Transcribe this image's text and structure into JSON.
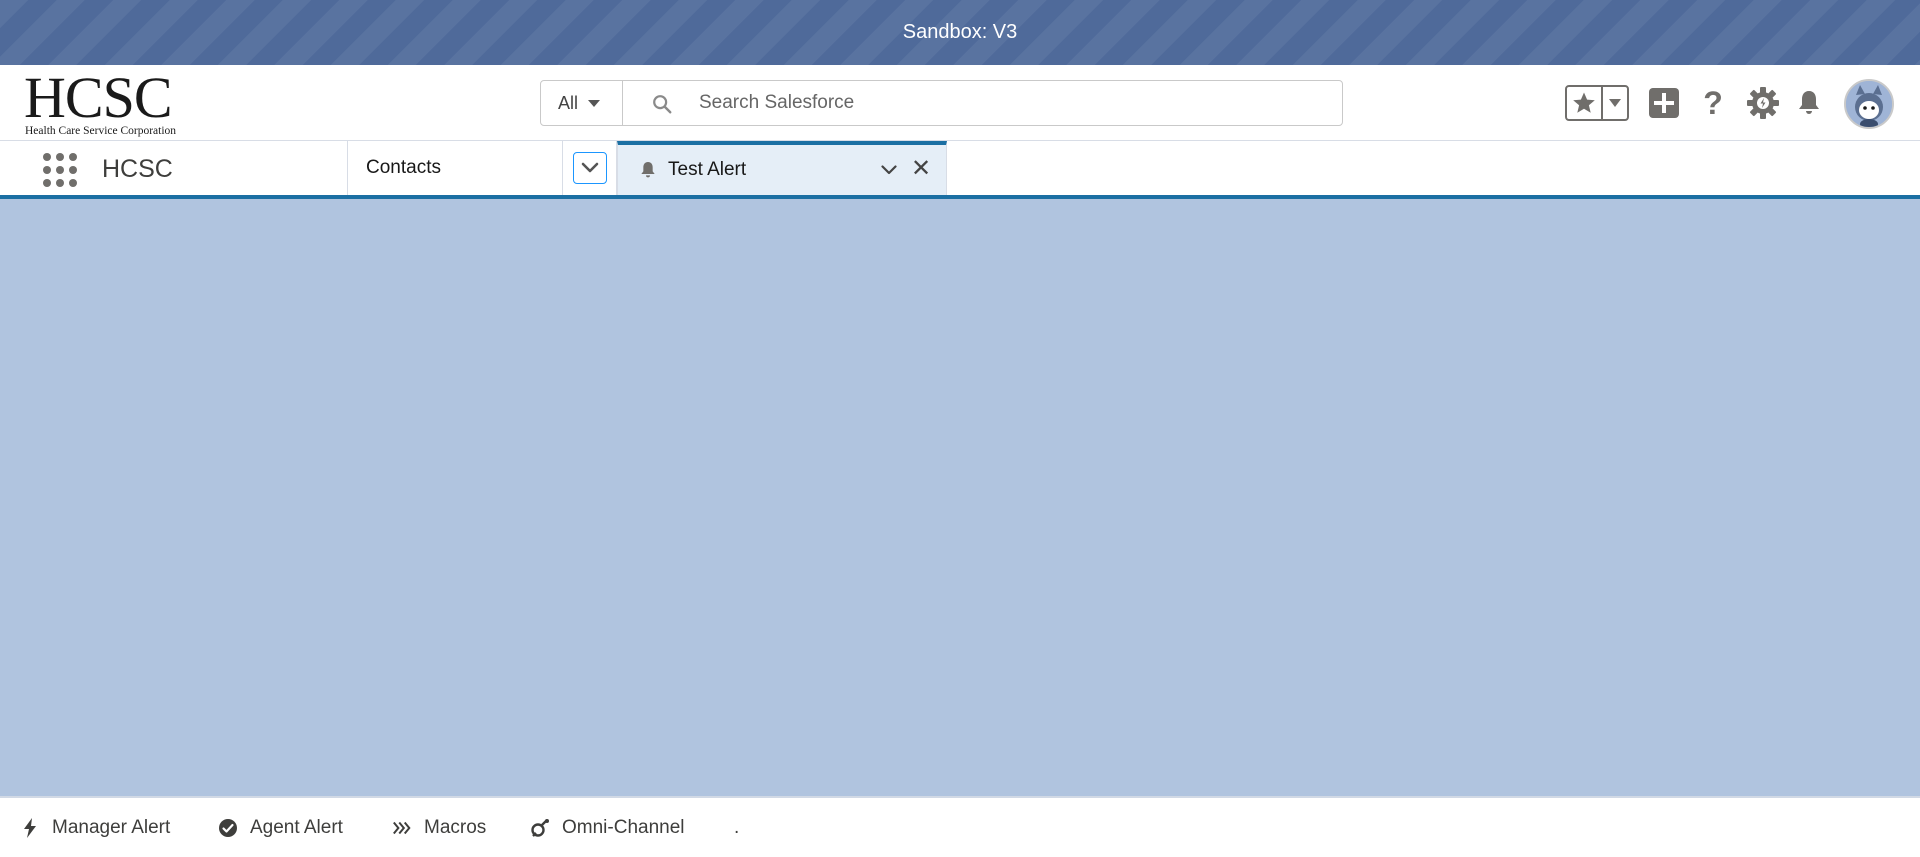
{
  "sandbox_banner": {
    "text": "Sandbox: V3"
  },
  "header": {
    "logo": {
      "main": "HCSC",
      "sub": "Health Care Service Corporation"
    },
    "search": {
      "scope": "All",
      "placeholder": "Search Salesforce"
    },
    "icons": [
      "star-icon",
      "chevron-down-icon",
      "add-icon",
      "help-icon",
      "setup-gear-icon",
      "notification-bell-icon",
      "avatar"
    ]
  },
  "nav": {
    "app_name": "HCSC",
    "tabs": [
      {
        "label": "Contacts"
      },
      {
        "label": "Test Alert",
        "active": true,
        "icon": "bell-icon"
      }
    ]
  },
  "utility_bar": {
    "items": [
      {
        "label": "Manager Alert",
        "icon": "lightning-icon"
      },
      {
        "label": "Agent Alert",
        "icon": "check-circle-icon"
      },
      {
        "label": "Macros",
        "icon": "macros-icon"
      },
      {
        "label": "Omni-Channel",
        "icon": "omni-channel-icon"
      },
      {
        "label": "."
      }
    ]
  },
  "colors": {
    "banner": "#4f6a9a",
    "nav_accent": "#1b6fa3",
    "main_background": "#b0c4df",
    "active_tab": "#e5eef7"
  }
}
